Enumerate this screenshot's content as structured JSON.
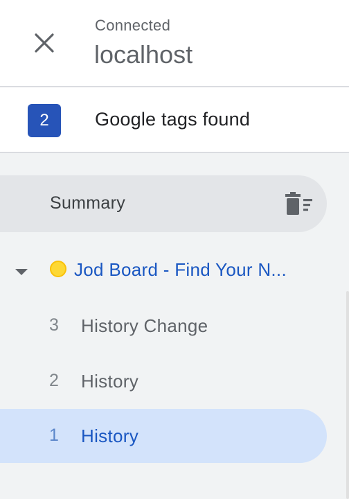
{
  "header": {
    "status": "Connected",
    "host": "localhost",
    "close_icon": "close-icon"
  },
  "tags": {
    "count": "2",
    "label": "Google tags found"
  },
  "summary": {
    "label": "Summary",
    "clear_icon": "clear-all-icon"
  },
  "container": {
    "title": "Jod Board - Find Your N...",
    "status_color": "#fdd835",
    "expanded": true
  },
  "events": [
    {
      "num": "3",
      "name": "History Change",
      "selected": false
    },
    {
      "num": "2",
      "name": "History",
      "selected": false
    },
    {
      "num": "1",
      "name": "History",
      "selected": true
    }
  ],
  "colors": {
    "accent": "#1a57c2",
    "badge": "#2754b8",
    "selected_bg": "#d3e3fb"
  }
}
